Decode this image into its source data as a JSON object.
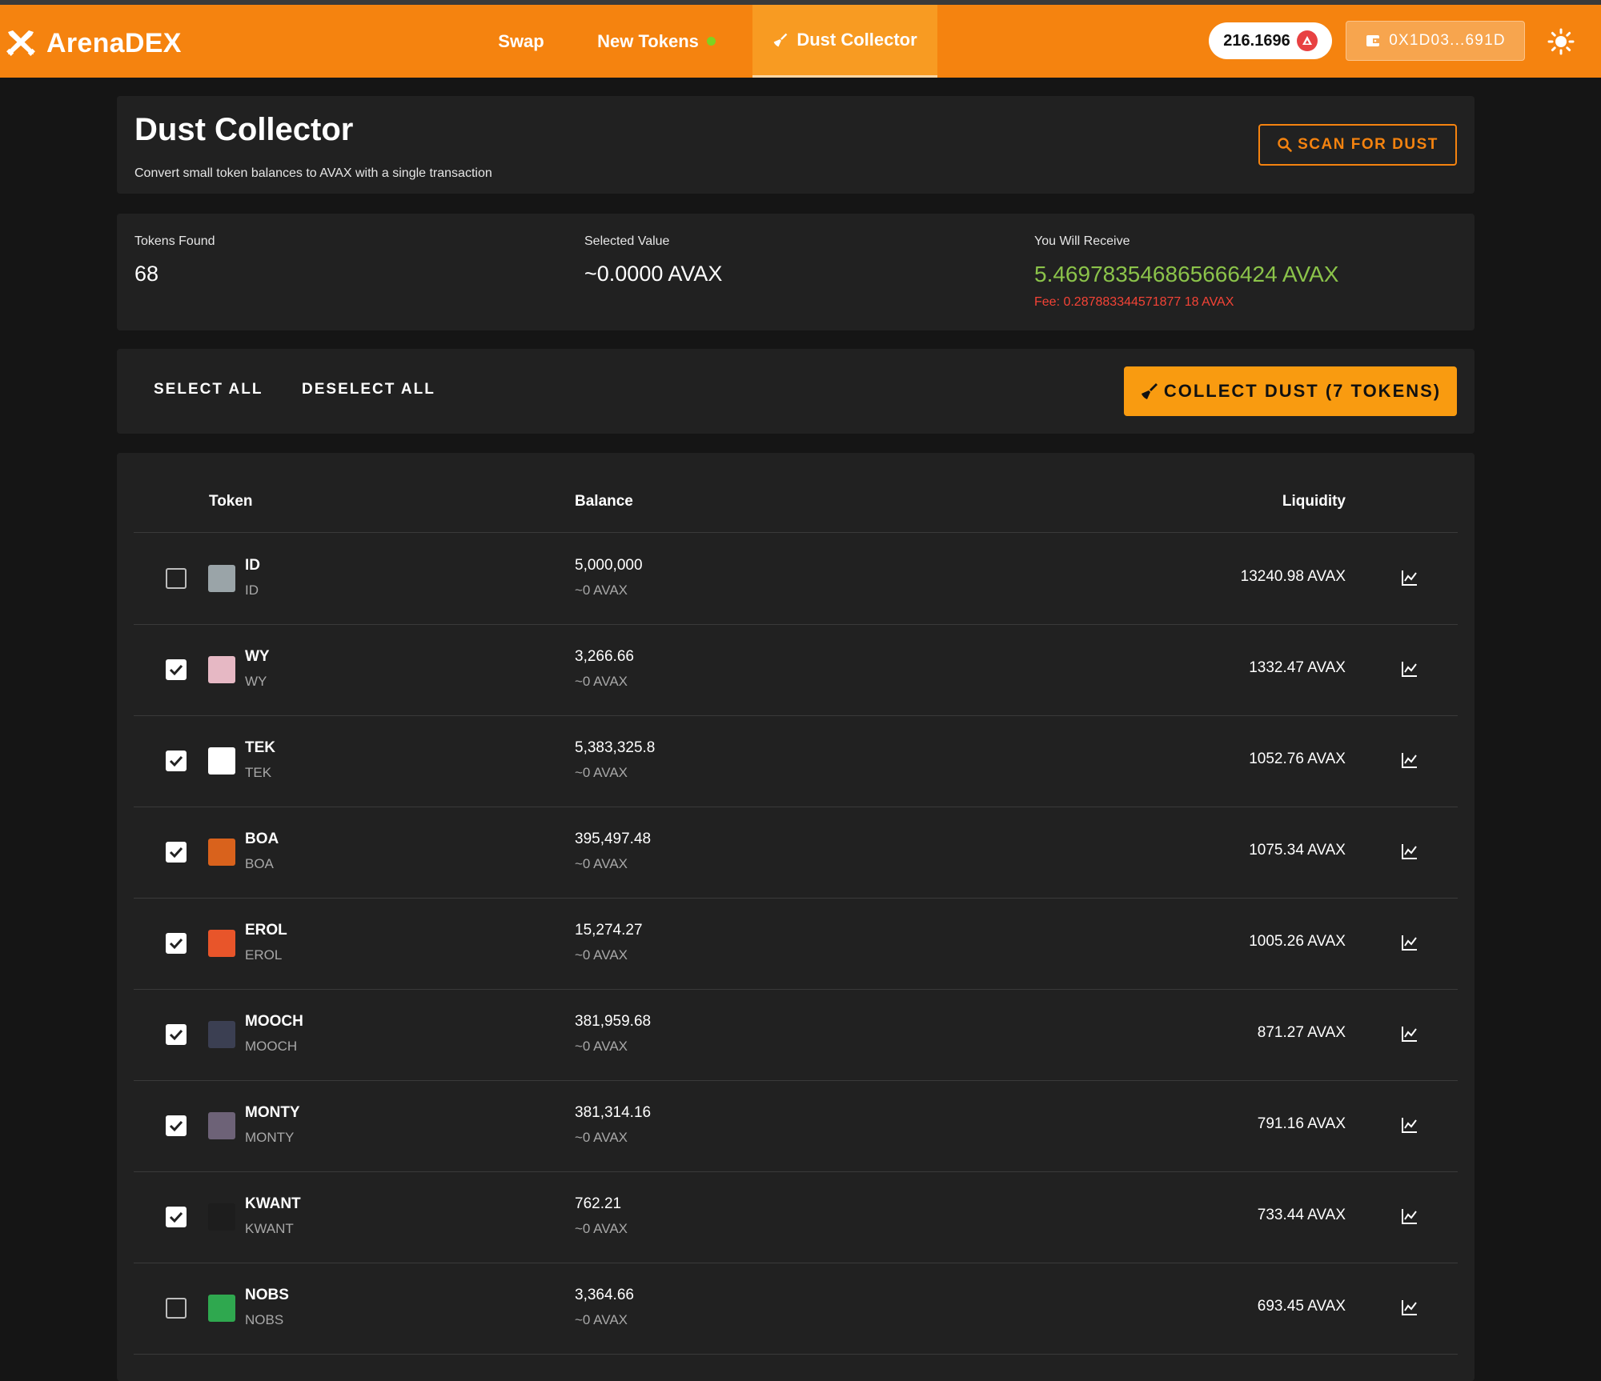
{
  "app": {
    "name": "ArenaDEX"
  },
  "nav": {
    "swap": "Swap",
    "new_tokens": "New Tokens",
    "dust_collector": "Dust Collector"
  },
  "header": {
    "balance": "216.1696",
    "wallet": "0X1D03...691D"
  },
  "page": {
    "title": "Dust Collector",
    "subtitle": "Convert small token balances to AVAX with a single transaction",
    "scan_label": "SCAN FOR DUST"
  },
  "stats": {
    "tokens_found_label": "Tokens Found",
    "tokens_found": "68",
    "selected_value_label": "Selected Value",
    "selected_value": "~0.0000 AVAX",
    "receive_label": "You Will Receive",
    "receive_value": "5.469783546865666424 AVAX",
    "fee": "Fee: 0.287883344571877 18 AVAX"
  },
  "actions": {
    "select_all": "SELECT ALL",
    "deselect_all": "DESELECT ALL",
    "collect": "COLLECT DUST (7 TOKENS)"
  },
  "table": {
    "headers": {
      "token": "Token",
      "balance": "Balance",
      "liquidity": "Liquidity"
    },
    "rows": [
      {
        "name": "ID",
        "symbol": "ID",
        "balance": "5,000,000",
        "value": "~0 AVAX",
        "liquidity": "13240.98 AVAX",
        "checked": false,
        "icon": "id-token-icon",
        "color": "#9aa4a8"
      },
      {
        "name": "WY",
        "symbol": "WY",
        "balance": "3,266.66",
        "value": "~0 AVAX",
        "liquidity": "1332.47 AVAX",
        "checked": true,
        "icon": "wy-token-icon",
        "color": "#e6b8c4"
      },
      {
        "name": "TEK",
        "symbol": "TEK",
        "balance": "5,383,325.8",
        "value": "~0 AVAX",
        "liquidity": "1052.76 AVAX",
        "checked": true,
        "icon": "tek-token-icon",
        "color": "#ffffff"
      },
      {
        "name": "BOA",
        "symbol": "BOA",
        "balance": "395,497.48",
        "value": "~0 AVAX",
        "liquidity": "1075.34 AVAX",
        "checked": true,
        "icon": "boa-token-icon",
        "color": "#d9621c"
      },
      {
        "name": "EROL",
        "symbol": "EROL",
        "balance": "15,274.27",
        "value": "~0 AVAX",
        "liquidity": "1005.26 AVAX",
        "checked": true,
        "icon": "erol-token-icon",
        "color": "#e8552a"
      },
      {
        "name": "MOOCH",
        "symbol": "MOOCH",
        "balance": "381,959.68",
        "value": "~0 AVAX",
        "liquidity": "871.27 AVAX",
        "checked": true,
        "icon": "mooch-token-icon",
        "color": "#3b3f52"
      },
      {
        "name": "MONTY",
        "symbol": "MONTY",
        "balance": "381,314.16",
        "value": "~0 AVAX",
        "liquidity": "791.16 AVAX",
        "checked": true,
        "icon": "monty-token-icon",
        "color": "#6d6277"
      },
      {
        "name": "KWANT",
        "symbol": "KWANT",
        "balance": "762.21",
        "value": "~0 AVAX",
        "liquidity": "733.44 AVAX",
        "checked": true,
        "icon": "kwant-token-icon",
        "color": "#1d1d1d"
      },
      {
        "name": "NOBS",
        "symbol": "NOBS",
        "balance": "3,364.66",
        "value": "~0 AVAX",
        "liquidity": "693.45 AVAX",
        "checked": false,
        "icon": "nobs-token-icon",
        "color": "#2fa84f"
      }
    ]
  },
  "colors": {
    "brand": "#f5830f",
    "receive": "#8bc34a",
    "fee": "#f44336"
  }
}
